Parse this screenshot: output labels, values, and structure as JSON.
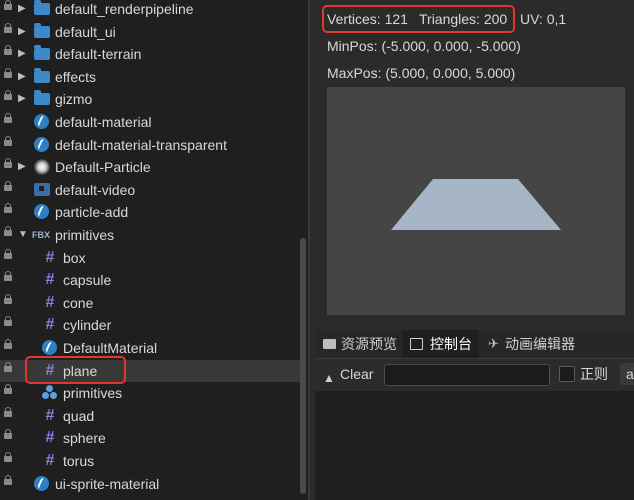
{
  "tree": [
    {
      "label": "default_renderpipeline",
      "icon": "folder-icon",
      "expander": "closed",
      "indent": 0
    },
    {
      "label": "default_ui",
      "icon": "folder-icon",
      "expander": "closed",
      "indent": 0
    },
    {
      "label": "default-terrain",
      "icon": "folder-icon",
      "expander": "closed",
      "indent": 0
    },
    {
      "label": "effects",
      "icon": "folder-icon",
      "expander": "closed",
      "indent": 0
    },
    {
      "label": "gizmo",
      "icon": "folder-icon",
      "expander": "closed",
      "indent": 0
    },
    {
      "label": "default-material",
      "icon": "material-icon",
      "expander": "none",
      "indent": 0
    },
    {
      "label": "default-material-transparent",
      "icon": "material-icon",
      "expander": "none",
      "indent": 0
    },
    {
      "label": "Default-Particle",
      "icon": "particle-icon",
      "expander": "closed",
      "indent": 0
    },
    {
      "label": "default-video",
      "icon": "video-icon",
      "expander": "none",
      "indent": 0
    },
    {
      "label": "particle-add",
      "icon": "material-icon",
      "expander": "none",
      "indent": 0
    },
    {
      "label": "primitives",
      "icon": "fbx-icon",
      "icon_text": "FBX",
      "expander": "open",
      "indent": 0
    },
    {
      "label": "box",
      "icon": "mesh-icon",
      "expander": "none",
      "indent": 1
    },
    {
      "label": "capsule",
      "icon": "mesh-icon",
      "expander": "none",
      "indent": 1
    },
    {
      "label": "cone",
      "icon": "mesh-icon",
      "expander": "none",
      "indent": 1
    },
    {
      "label": "cylinder",
      "icon": "mesh-icon",
      "expander": "none",
      "indent": 1
    },
    {
      "label": "DefaultMaterial",
      "icon": "material-icon",
      "expander": "none",
      "indent": 1
    },
    {
      "label": "plane",
      "icon": "mesh-icon",
      "expander": "none",
      "indent": 1,
      "selected": true
    },
    {
      "label": "primitives",
      "icon": "prefab-icon",
      "expander": "none",
      "indent": 1
    },
    {
      "label": "quad",
      "icon": "mesh-icon",
      "expander": "none",
      "indent": 1
    },
    {
      "label": "sphere",
      "icon": "mesh-icon",
      "expander": "none",
      "indent": 1
    },
    {
      "label": "torus",
      "icon": "mesh-icon",
      "expander": "none",
      "indent": 1
    },
    {
      "label": "ui-sprite-material",
      "icon": "material-icon",
      "expander": "none",
      "indent": 0
    }
  ],
  "inspector": {
    "vertices": "Vertices: 121",
    "triangles": "Triangles: 200",
    "uv": "UV: 0,1",
    "minpos": "MinPos: (-5.000, 0.000, -5.000)",
    "maxpos": "MaxPos: (5.000, 0.000, 5.000)"
  },
  "bottom_tabs": [
    {
      "label": "资源预览",
      "icon": "folder-icon",
      "active": false
    },
    {
      "label": "控制台",
      "icon": "console-icon",
      "active": true
    },
    {
      "label": "动画编辑器",
      "icon": "animation-icon",
      "active": false
    }
  ],
  "console": {
    "clear_label": "Clear",
    "filter_value": "",
    "regex_label": "正则",
    "level_value": "a"
  },
  "colors": {
    "highlight": "#e0372e",
    "folder": "#3d88c8",
    "mesh": "#8b7fe0",
    "preview_bg": "#454545",
    "plane": "#a7b6c6"
  }
}
